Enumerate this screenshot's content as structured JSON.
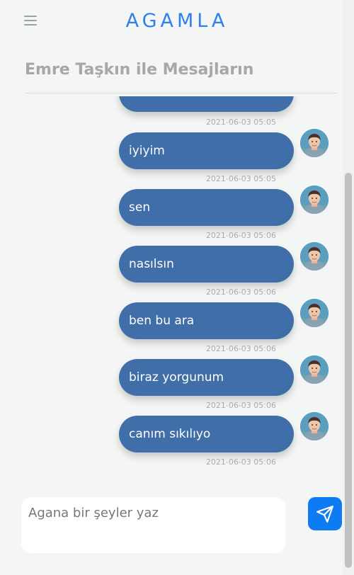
{
  "header": {
    "brand": "AGAMLA",
    "menu_icon": "hamburger-menu-icon"
  },
  "conversation": {
    "title": "Emre Taşkın ile Mesajların"
  },
  "messages": [
    {
      "text": "",
      "time": "2021-06-03 05:05"
    },
    {
      "text": "iyiyim",
      "time": "2021-06-03 05:05"
    },
    {
      "text": "sen",
      "time": "2021-06-03 05:06"
    },
    {
      "text": "nasılsın",
      "time": "2021-06-03 05:06"
    },
    {
      "text": "ben bu ara",
      "time": "2021-06-03 05:06"
    },
    {
      "text": "biraz yorgunum",
      "time": "2021-06-03 05:06"
    },
    {
      "text": "canım sıkılıyo",
      "time": "2021-06-03 05:06"
    }
  ],
  "composer": {
    "placeholder": "Agana bir şeyler yaz",
    "send_icon": "paper-plane-icon"
  },
  "colors": {
    "brand": "#2f80ed",
    "bubble": "#3f6ea8",
    "send_button": "#0d7bf2"
  }
}
